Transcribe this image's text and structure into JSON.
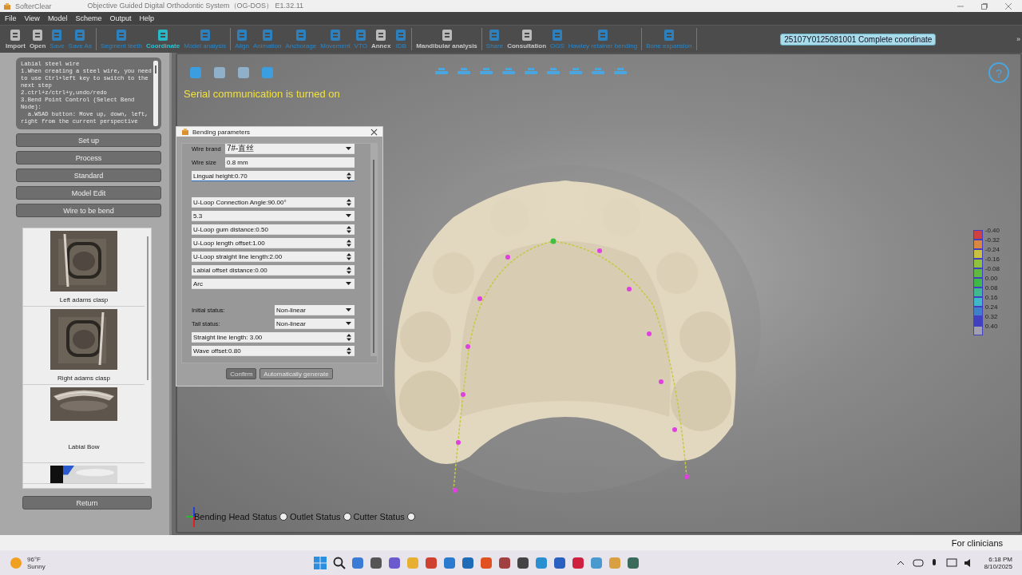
{
  "window": {
    "app_name": "SofterClear",
    "title": "Objective Guided Digital Orthodontic System（OG-DOS） E1.32.11"
  },
  "menu": [
    "File",
    "View",
    "Model",
    "Scheme",
    "Output",
    "Help"
  ],
  "toolbar": {
    "groups": [
      [
        {
          "label": "Import",
          "disabled": false,
          "selected": false
        },
        {
          "label": "Open",
          "disabled": false,
          "selected": false
        },
        {
          "label": "Save",
          "disabled": true,
          "selected": false
        },
        {
          "label": "Save As",
          "disabled": true,
          "selected": false
        }
      ],
      [
        {
          "label": "Segment teeth",
          "disabled": true,
          "selected": false
        },
        {
          "label": "Coordinate",
          "disabled": false,
          "selected": true
        },
        {
          "label": "Model analysis",
          "disabled": true,
          "selected": false
        }
      ],
      [
        {
          "label": "Align",
          "disabled": true,
          "selected": false
        },
        {
          "label": "Animation",
          "disabled": true,
          "selected": false
        },
        {
          "label": "Anchorage",
          "disabled": true,
          "selected": false
        },
        {
          "label": "Movement",
          "disabled": true,
          "selected": false
        },
        {
          "label": "VTO",
          "disabled": true,
          "selected": false
        },
        {
          "label": "Annex",
          "disabled": false,
          "selected": false
        },
        {
          "label": "IDB",
          "disabled": true,
          "selected": false
        }
      ],
      [
        {
          "label": "Mandibular analysis",
          "disabled": false,
          "selected": false
        }
      ],
      [
        {
          "label": "Share",
          "disabled": true,
          "selected": false
        },
        {
          "label": "Consultation",
          "disabled": false,
          "selected": false
        },
        {
          "label": "OGS",
          "disabled": true,
          "selected": false
        },
        {
          "label": "Hawley retainer bending",
          "disabled": true,
          "selected": false
        }
      ],
      [
        {
          "label": "Bone expansion",
          "disabled": true,
          "selected": false
        }
      ]
    ],
    "badge": "25107Y0125081001 Complete coordinate",
    "overflow": "»"
  },
  "sidebar": {
    "help_lines": [
      "Labial steel wire",
      "1.When creating a steel wire, you need",
      "to use Ctrl+left key to switch to the",
      "next step",
      "2.ctrl+z/ctrl+y,undo/redo",
      "3.Bend Point Control (Select Bend",
      "Node):",
      "  a.WSAD button: Move up, down, left,",
      "right from the current perspective"
    ],
    "buttons": [
      "Set up",
      "Process",
      "Standard",
      "Model Edit",
      "Wire to be bend"
    ],
    "gallery": [
      {
        "kind": "picture",
        "caption": "Left adams clasp"
      },
      {
        "kind": "picture",
        "caption": "Right adams clasp"
      },
      {
        "kind": "picture",
        "caption": "Labial Bow"
      },
      {
        "kind": "picture"
      }
    ],
    "return_button": "Return"
  },
  "viewport": {
    "notice": "Serial communication is turned on",
    "help_glyph": "?",
    "legend": [
      {
        "label": "-0.40",
        "color": "#d04040"
      },
      {
        "label": "-0.32",
        "color": "#d88840"
      },
      {
        "label": "-0.24",
        "color": "#c8c040"
      },
      {
        "label": "-0.16",
        "color": "#90c040"
      },
      {
        "label": "-0.08",
        "color": "#60b840"
      },
      {
        "label": "0.00",
        "color": "#40b848"
      },
      {
        "label": "0.08",
        "color": "#40b890"
      },
      {
        "label": "0.16",
        "color": "#40b8c8"
      },
      {
        "label": "0.24",
        "color": "#4080c8"
      },
      {
        "label": "0.32",
        "color": "#4040c0"
      },
      {
        "label": "0.40",
        "color": "#a0a0b0"
      }
    ],
    "statuses": [
      {
        "label": "Bending Head Status",
        "checked": false
      },
      {
        "label": "Outlet  Status",
        "checked": false
      },
      {
        "label": "Cutter  Status",
        "checked": false
      }
    ]
  },
  "dialog": {
    "title": "Bending parameters",
    "field_groups": [
      [
        {
          "kind": "combo",
          "label": "Wire brand",
          "value": "7#-直丝",
          "focused": false
        },
        {
          "kind": "text",
          "label": "Wire size",
          "value": "0.8 mm",
          "focused": false
        },
        {
          "kind": "spin",
          "value": "Lingual height:0.70",
          "focused": true
        }
      ],
      [
        {
          "kind": "spin",
          "value": "U-Loop Connection Angle:90.00°",
          "focused": false
        },
        {
          "kind": "select",
          "value": "5.3",
          "focused": false
        },
        {
          "kind": "spin",
          "value": "U-Loop gum distance:0.50",
          "focused": false
        },
        {
          "kind": "spin",
          "value": "U-Loop length offset:1.00",
          "focused": false
        },
        {
          "kind": "spin",
          "value": "U-Loop straight line length:2.00",
          "focused": false
        },
        {
          "kind": "spin",
          "value": "Labial offset distance:0.00",
          "focused": false
        },
        {
          "kind": "select",
          "value": "Arc",
          "focused": false
        }
      ],
      [
        {
          "kind": "pair",
          "label": "Initial status:",
          "value": "Non-linear",
          "focused": false
        },
        {
          "kind": "pair",
          "label": "Tail status:",
          "value": "Non-linear",
          "focused": false
        },
        {
          "kind": "spin",
          "value": "Straight line length: 3.00",
          "focused": false
        },
        {
          "kind": "spin",
          "value": "Wave offset:0.80",
          "focused": false
        }
      ]
    ],
    "buttons": [
      {
        "label": "Confirm",
        "disabled": false
      },
      {
        "label": "Automatically generate",
        "disabled": true
      }
    ]
  },
  "status_bar": {
    "text": "For clinicians"
  },
  "taskbar": {
    "weather": {
      "temp": "96°F",
      "condition": "Sunny"
    },
    "clock": {
      "time": "6:18 PM",
      "date": "8/10/2025"
    }
  }
}
